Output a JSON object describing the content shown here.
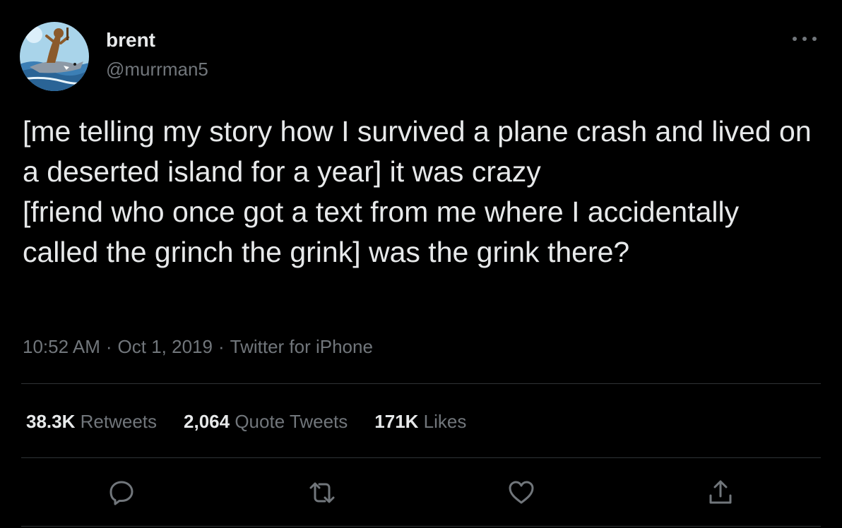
{
  "user": {
    "display_name": "brent",
    "handle": "@murrman5",
    "avatar_icon": "avatar-icon"
  },
  "tweet": {
    "text": "[me telling my story how I survived a plane crash and lived on a deserted island for a year] it was crazy\n[friend who once got a text from me where I accidentally called the grinch the grink] was the grink there?",
    "time": "10:52 AM",
    "date": "Oct 1, 2019",
    "source": "Twitter for iPhone",
    "separator": "·"
  },
  "stats": {
    "retweets": {
      "value": "38.3K",
      "label": "Retweets"
    },
    "quote_tweets": {
      "value": "2,064",
      "label": "Quote Tweets"
    },
    "likes": {
      "value": "171K",
      "label": "Likes"
    }
  },
  "actions": {
    "reply_icon": "reply-icon",
    "retweet_icon": "retweet-icon",
    "like_icon": "heart-icon",
    "share_icon": "share-icon",
    "more_icon": "more-icon"
  },
  "colors": {
    "background": "#000000",
    "primary_text": "#e7e9ea",
    "secondary_text": "#71767b",
    "divider": "#2f3336",
    "avatar_sky": "#a9d4ea"
  }
}
